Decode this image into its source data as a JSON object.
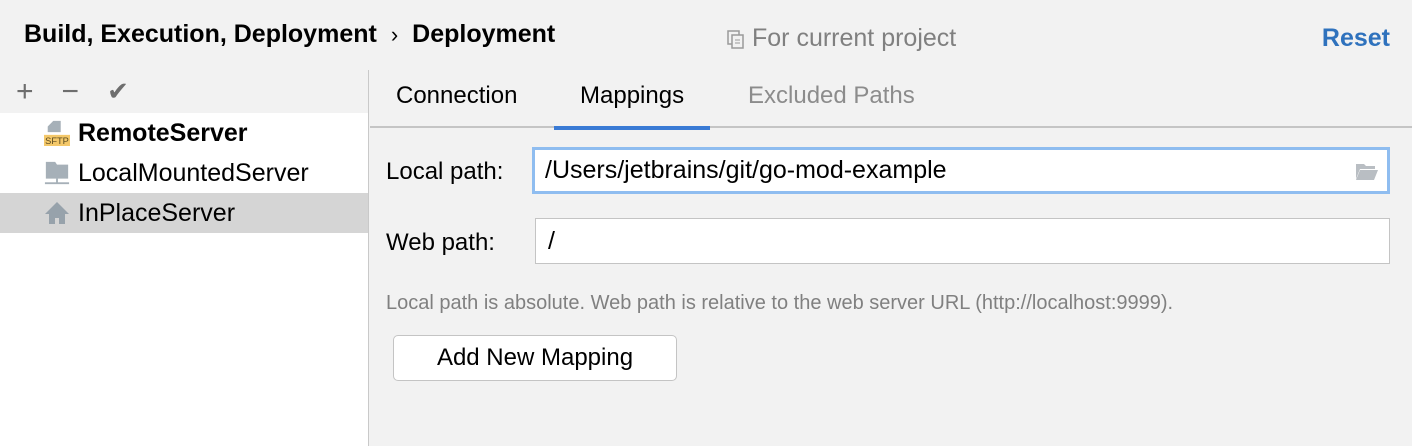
{
  "header": {
    "breadcrumb": [
      "Build, Execution, Deployment",
      "Deployment"
    ],
    "separator": "›",
    "scope": "For current project",
    "reset": "Reset"
  },
  "toolbar": {
    "add": "+",
    "remove": "−",
    "apply": "✔"
  },
  "servers": [
    {
      "name": "RemoteServer",
      "icon": "sftp-icon",
      "badge": "SFTP",
      "bold": true
    },
    {
      "name": "LocalMountedServer",
      "icon": "mounted-folder-icon"
    },
    {
      "name": "InPlaceServer",
      "icon": "home-icon",
      "selected": true
    }
  ],
  "tabs": [
    {
      "label": "Connection"
    },
    {
      "label": "Mappings",
      "active": true
    },
    {
      "label": "Excluded Paths",
      "disabled": true
    }
  ],
  "mappings": {
    "local_label": "Local path:",
    "local_value": "/Users/jetbrains/git/go-mod-example",
    "web_label": "Web path:",
    "web_value": "/",
    "hint": "Local path is absolute. Web path is relative to the web server URL (http://localhost:9999).",
    "add_button": "Add New Mapping"
  },
  "colors": {
    "accent": "#2f72bd",
    "selection": "#d5d5d5",
    "focus": "#8fbdf0"
  }
}
